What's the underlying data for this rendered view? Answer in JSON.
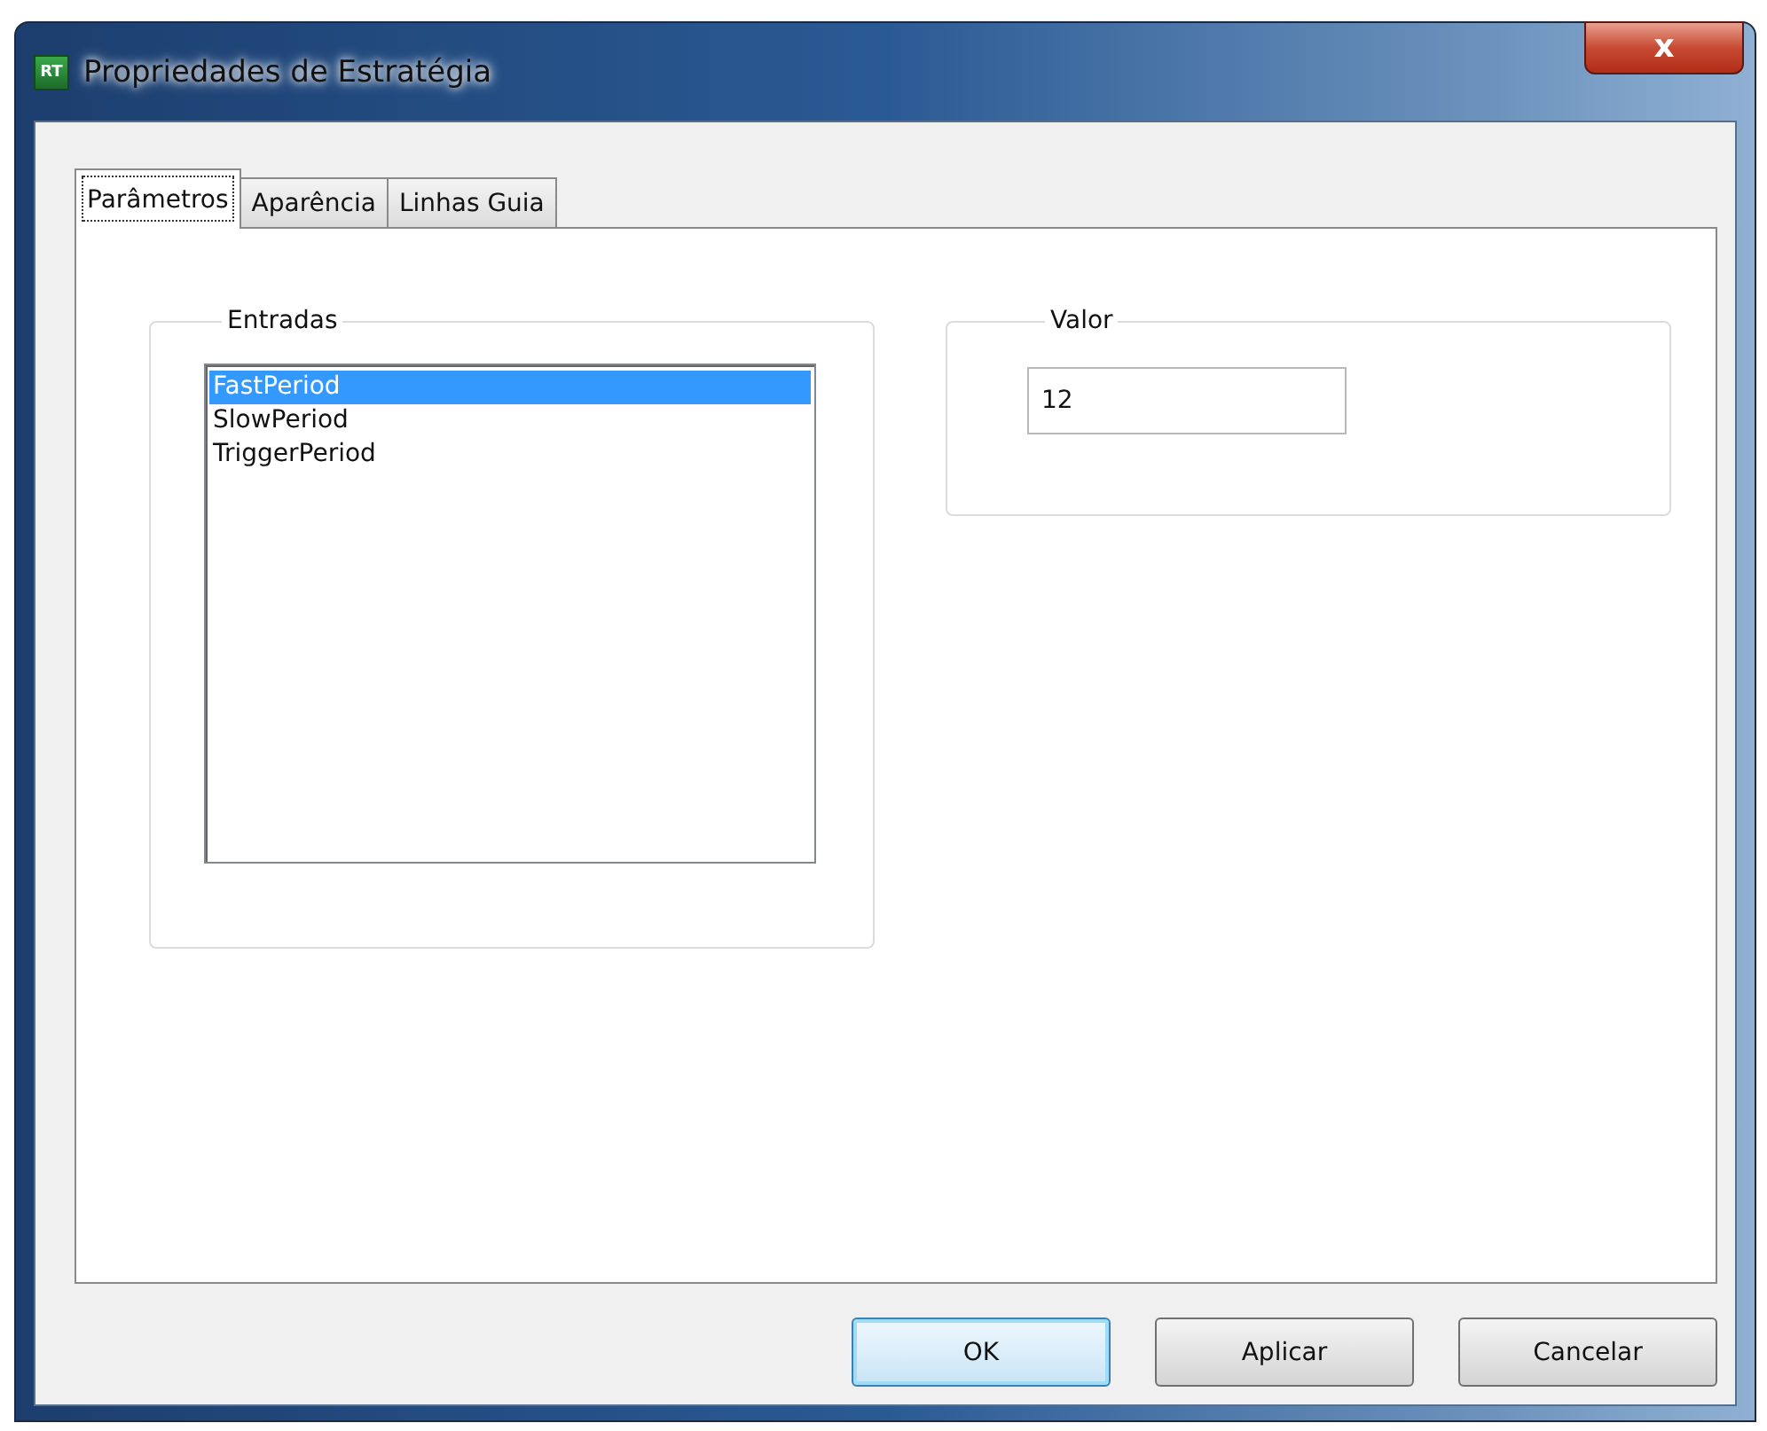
{
  "window": {
    "title": "Propriedades de Estratégia",
    "icon_text": "RT",
    "close": "x"
  },
  "tabs": [
    {
      "label": "Parâmetros",
      "selected": true
    },
    {
      "label": "Aparência",
      "selected": false
    },
    {
      "label": "Linhas Guia",
      "selected": false
    }
  ],
  "inputs_group": {
    "title": "Entradas",
    "items": [
      {
        "label": "FastPeriod",
        "selected": true
      },
      {
        "label": "SlowPeriod",
        "selected": false
      },
      {
        "label": "TriggerPeriod",
        "selected": false
      }
    ]
  },
  "value_group": {
    "title": "Valor",
    "value": "12"
  },
  "buttons": [
    {
      "label": "OK",
      "default": true
    },
    {
      "label": "Aplicar",
      "default": false
    },
    {
      "label": "Cancelar",
      "default": false
    }
  ]
}
